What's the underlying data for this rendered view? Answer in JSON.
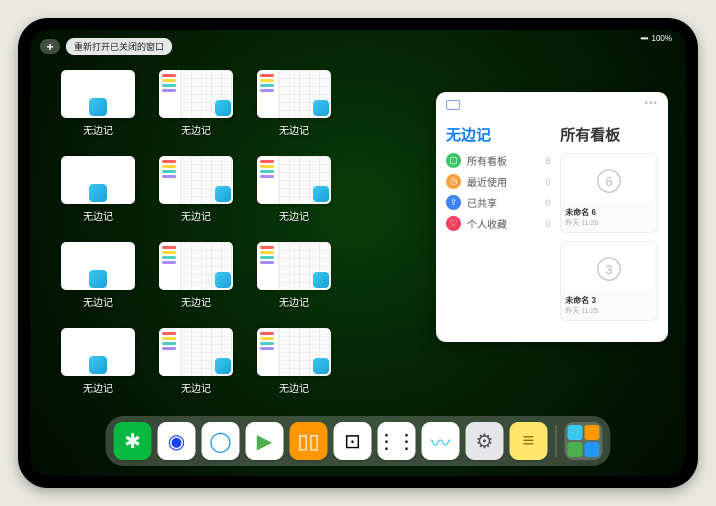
{
  "status": {
    "battery": "100%",
    "signal": "••••"
  },
  "topbar": {
    "add": "+",
    "reopen": "重新打开已关闭的窗口"
  },
  "tiles": [
    {
      "label": "无边记",
      "type": "blank"
    },
    {
      "label": "无边记",
      "type": "cal"
    },
    {
      "label": "无边记",
      "type": "cal"
    },
    {
      "label": "无边记",
      "type": "blank"
    },
    {
      "label": "无边记",
      "type": "cal"
    },
    {
      "label": "无边记",
      "type": "cal"
    },
    {
      "label": "无边记",
      "type": "blank"
    },
    {
      "label": "无边记",
      "type": "cal"
    },
    {
      "label": "无边记",
      "type": "cal"
    },
    {
      "label": "无边记",
      "type": "blank"
    },
    {
      "label": "无边记",
      "type": "cal"
    },
    {
      "label": "无边记",
      "type": "cal"
    }
  ],
  "panel": {
    "left_title": "无边记",
    "right_title": "所有看板",
    "menu": [
      {
        "icon": "▢",
        "color": "c0",
        "label": "所有看板",
        "count": "8"
      },
      {
        "icon": "◷",
        "color": "c1",
        "label": "最近使用",
        "count": "0"
      },
      {
        "icon": "⇪",
        "color": "c2",
        "label": "已共享",
        "count": "0"
      },
      {
        "icon": "♡",
        "color": "c3",
        "label": "个人收藏",
        "count": "0"
      }
    ],
    "cards": [
      {
        "digit": "6",
        "label": "未命名 6",
        "sub": "昨天 11:26"
      },
      {
        "digit": "3",
        "label": "未命名 3",
        "sub": "昨天 11:25"
      }
    ]
  },
  "dock": [
    {
      "name": "wechat",
      "bg": "#09b83e",
      "glyph": "✱",
      "fg": "#fff"
    },
    {
      "name": "hd",
      "bg": "#fff",
      "glyph": "◉",
      "fg": "#1e40ff"
    },
    {
      "name": "quark",
      "bg": "#fff",
      "glyph": "◯",
      "fg": "#2196f3"
    },
    {
      "name": "play",
      "bg": "#fff",
      "glyph": "▶",
      "fg": "#4caf50"
    },
    {
      "name": "books",
      "bg": "#ff9800",
      "glyph": "▯▯",
      "fg": "#fff"
    },
    {
      "name": "dice",
      "bg": "#fff",
      "glyph": "⊡",
      "fg": "#000"
    },
    {
      "name": "dots",
      "bg": "#fff",
      "glyph": "⋮⋮",
      "fg": "#000"
    },
    {
      "name": "freeform",
      "bg": "#fff",
      "glyph": "〰",
      "fg": "#3bc9f0"
    },
    {
      "name": "settings",
      "bg": "#e5e5ea",
      "glyph": "⚙",
      "fg": "#555"
    },
    {
      "name": "notes",
      "bg": "#ffe66d",
      "glyph": "≡",
      "fg": "#8b6f00"
    }
  ],
  "recent_group": [
    "#3bc9f0",
    "#ff9800",
    "#4caf50",
    "#2196f3"
  ]
}
